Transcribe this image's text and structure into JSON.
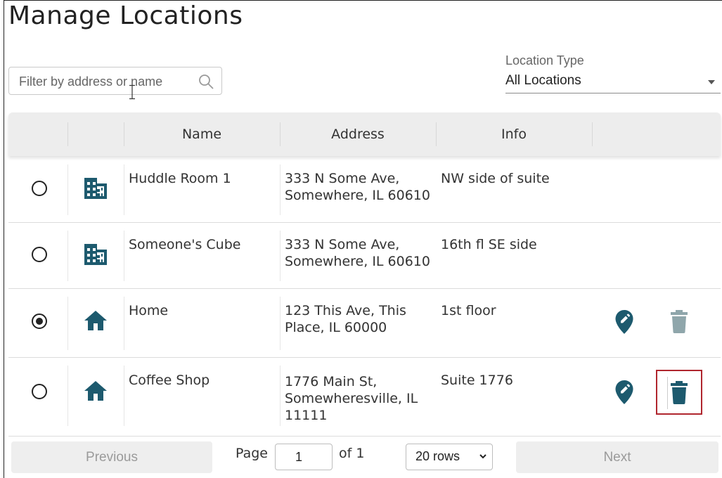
{
  "page": {
    "title": "Manage Locations"
  },
  "filter": {
    "placeholder": "Filter by address or name",
    "value": ""
  },
  "location_type": {
    "label": "Location Type",
    "value": "All Locations"
  },
  "table": {
    "headers": [
      "",
      "",
      "Name",
      "Address",
      "Info",
      ""
    ],
    "rows": [
      {
        "selected": false,
        "type_icon": "building-icon",
        "name": "Huddle Room 1",
        "address_line1": "333 N Some Ave,",
        "address_line2": "Somewhere, IL 60610",
        "address_line3": "",
        "info": "NW side of suite",
        "actions": []
      },
      {
        "selected": false,
        "type_icon": "building-icon",
        "name": "Someone's Cube",
        "address_line1": "333 N Some Ave,",
        "address_line2": "Somewhere, IL 60610",
        "address_line3": "",
        "info": "16th fl SE side",
        "actions": []
      },
      {
        "selected": true,
        "type_icon": "home-icon",
        "name": "Home",
        "address_line1": "123 This Ave, This",
        "address_line2": "Place, IL 60000",
        "address_line3": "",
        "info": "1st floor",
        "actions": [
          "edit-location-icon",
          "delete-icon-disabled"
        ]
      },
      {
        "selected": false,
        "type_icon": "home-icon",
        "name": "Coffee Shop",
        "address_line1": "1776 Main St,",
        "address_line2": "Somewheresville, IL",
        "address_line3": "11111",
        "info": "Suite 1776",
        "actions": [
          "edit-location-icon",
          "delete-icon-highlighted"
        ]
      }
    ]
  },
  "pagination": {
    "previous_label": "Previous",
    "page_label": "Page",
    "page_value": "1",
    "of_label": "of 1",
    "rows_label": "20 rows",
    "next_label": "Next"
  },
  "colors": {
    "accent": "#1d5a6e",
    "disabled_icon": "#8fa6ab",
    "highlight_border": "#b0262e",
    "header_bg": "#ededed"
  }
}
